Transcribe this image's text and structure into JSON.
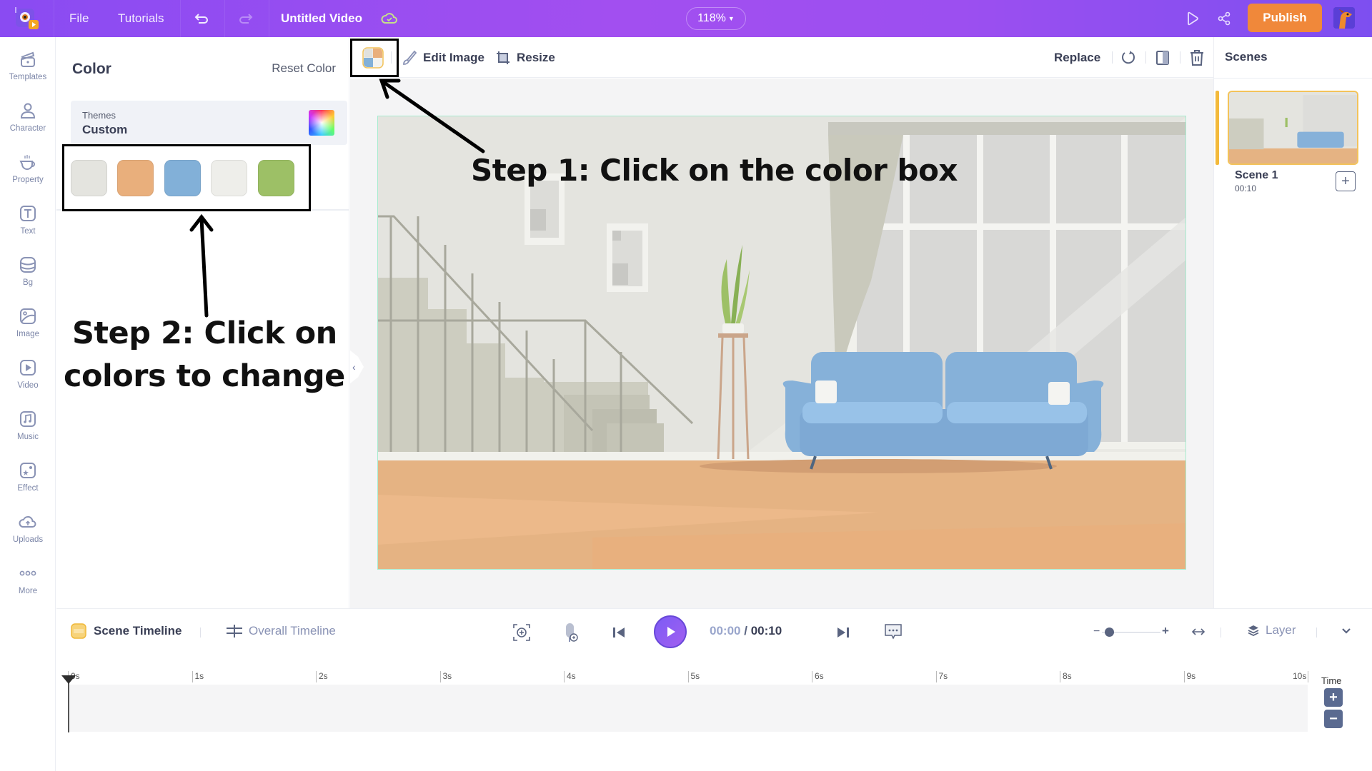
{
  "topbar": {
    "file_label": "File",
    "tutorials_label": "Tutorials",
    "project_title": "Untitled Video",
    "zoom_level": "118%",
    "publish_label": "Publish"
  },
  "rail": {
    "items": [
      {
        "label": "Templates",
        "icon": "clapperboard-icon"
      },
      {
        "label": "Character",
        "icon": "person-icon"
      },
      {
        "label": "Property",
        "icon": "cup-icon"
      },
      {
        "label": "Text",
        "icon": "text-icon"
      },
      {
        "label": "Bg",
        "icon": "layers-icon"
      },
      {
        "label": "Image",
        "icon": "image-icon"
      },
      {
        "label": "Video",
        "icon": "video-icon"
      },
      {
        "label": "Music",
        "icon": "music-icon"
      },
      {
        "label": "Effect",
        "icon": "effect-icon"
      },
      {
        "label": "Uploads",
        "icon": "cloud-upload-icon"
      },
      {
        "label": "More",
        "icon": "more-dots-icon"
      }
    ]
  },
  "color_panel": {
    "title": "Color",
    "reset_label": "Reset Color",
    "themes_label": "Themes",
    "themes_value": "Custom",
    "swatches": [
      "#e4e4df",
      "#e9af7c",
      "#82b0d8",
      "#eeeeea",
      "#9dc066"
    ]
  },
  "toolbar": {
    "edit_image_label": "Edit Image",
    "resize_label": "Resize",
    "replace_label": "Replace"
  },
  "scenes": {
    "title": "Scenes",
    "items": [
      {
        "name": "Scene 1",
        "duration": "00:10"
      }
    ]
  },
  "timeline": {
    "scene_timeline_label": "Scene Timeline",
    "overall_timeline_label": "Overall Timeline",
    "current_time": "00:00",
    "separator": "/",
    "total_time": "00:10",
    "layer_label": "Layer",
    "time_label": "Time",
    "zoom_slider_fraction": 0.12,
    "ticks": [
      "0s",
      "1s",
      "2s",
      "3s",
      "4s",
      "5s",
      "6s",
      "7s",
      "8s",
      "9s",
      "10s"
    ]
  },
  "annotations": {
    "step1": "Step 1: Click on the color box",
    "step2_line1": "Step 2: Click on",
    "step2_line2": "colors to change"
  },
  "colors": {
    "brand_purple": "#9a4ff0",
    "publish_orange": "#f0883a",
    "play_button": "#8b5cf6",
    "scene_accent": "#f3b93a"
  }
}
